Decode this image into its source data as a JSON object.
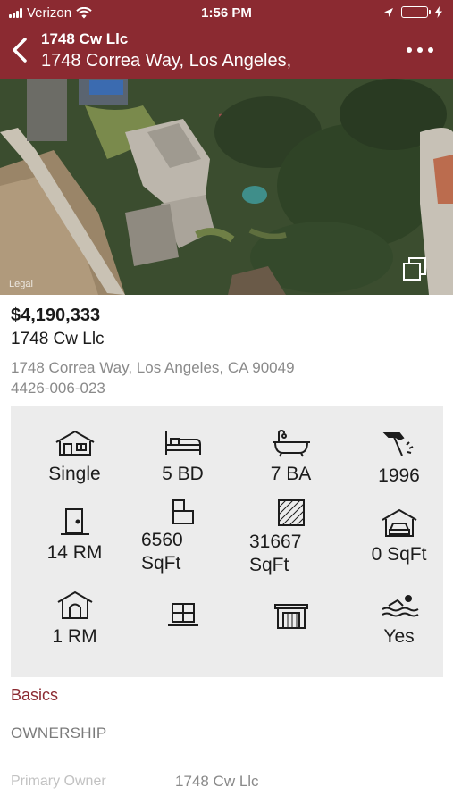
{
  "status_bar": {
    "carrier": "Verizon",
    "time": "1:56 PM"
  },
  "header": {
    "title": "1748 Cw Llc",
    "subtitle": "1748 Correa Way, Los Angeles,"
  },
  "map": {
    "legal_label": "Legal"
  },
  "property": {
    "price": "$4,190,333",
    "owner": "1748 Cw Llc",
    "address": "1748 Correa Way, Los Angeles, CA 90049",
    "apn": "4426-006-023"
  },
  "features": {
    "type": "Single",
    "beds": "5 BD",
    "baths": "7 BA",
    "year_built": "1996",
    "rooms": "14 RM",
    "building_sqft_value": "6560",
    "building_sqft_unit": "SqFt",
    "lot_sqft_value": "31667",
    "lot_sqft_unit": "SqFt",
    "garage": "0 SqFt",
    "stories": "1 RM",
    "pool": "Yes"
  },
  "sections": {
    "basics": "Basics",
    "ownership": "OWNERSHIP",
    "primary_owner_label": "Primary Owner",
    "primary_owner_value": "1748 Cw Llc"
  },
  "colors": {
    "brand": "#8b2a31",
    "panel": "#ececec"
  }
}
